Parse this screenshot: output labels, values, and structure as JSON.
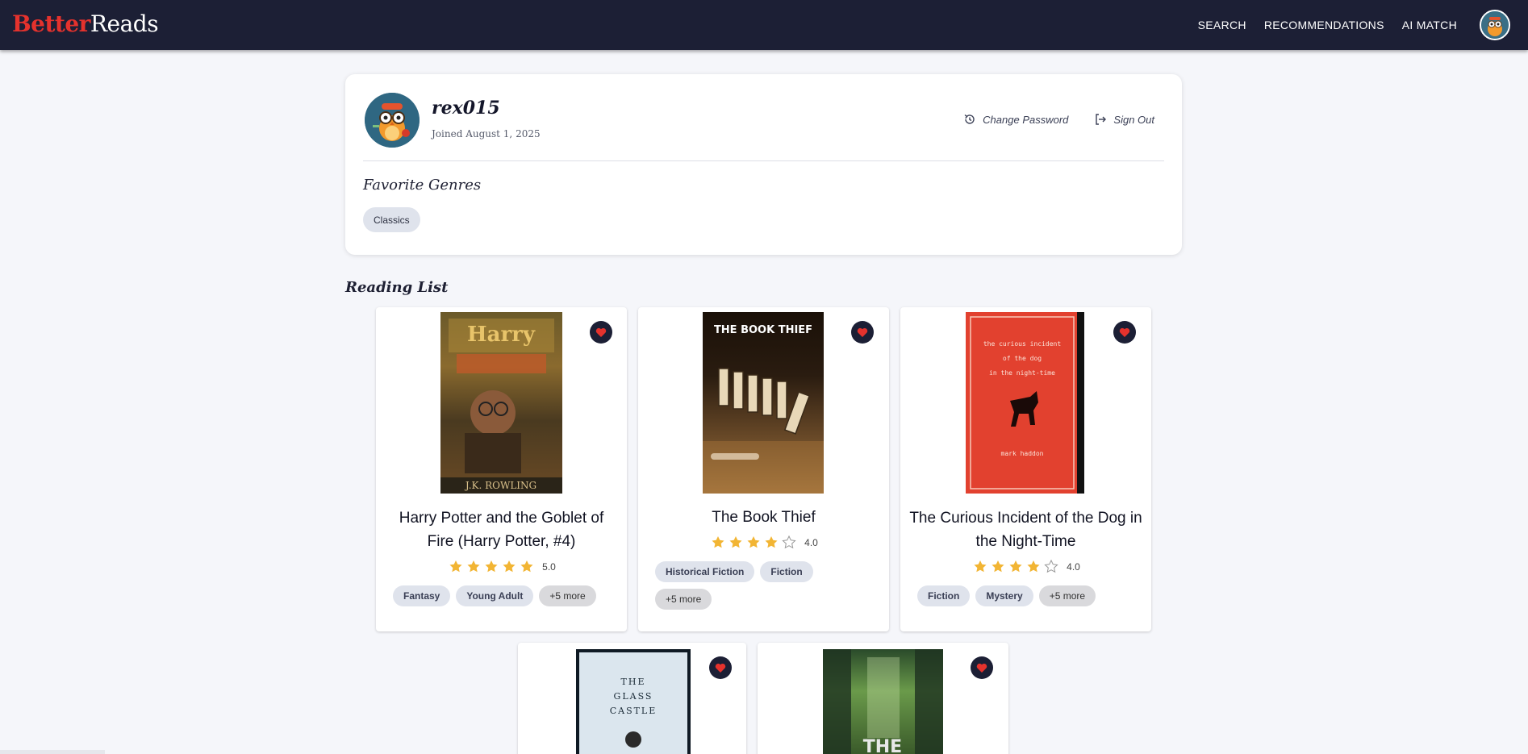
{
  "app": {
    "logo_part1": "Better",
    "logo_part2": "Reads",
    "accent_color": "#e5322d",
    "nav_bg_color": "#1c1f35"
  },
  "nav": {
    "items": [
      {
        "label": "SEARCH"
      },
      {
        "label": "RECOMMENDATIONS"
      },
      {
        "label": "AI MATCH"
      }
    ],
    "avatar_icon": "owl-avatar-icon"
  },
  "profile": {
    "username": "rex015",
    "joined": "Joined August 1, 2025",
    "change_password_label": "Change Password",
    "sign_out_label": "Sign Out",
    "favorite_genres_title": "Favorite Genres",
    "favorite_genres": [
      "Classics"
    ]
  },
  "reading_list": {
    "title": "Reading List",
    "books": [
      {
        "title": "Harry Potter and the Goblet of Fire (Harry Potter, #4)",
        "rating": 5.0,
        "rating_label": "5.0",
        "genres": [
          "Fantasy",
          "Young Adult"
        ],
        "more_label": "+5 more",
        "favorited": true
      },
      {
        "title": "The Book Thief",
        "rating": 4.0,
        "rating_label": "4.0",
        "genres": [
          "Historical Fiction",
          "Fiction"
        ],
        "more_label": "+5 more",
        "favorited": true
      },
      {
        "title": "The Curious Incident of the Dog in the Night-Time",
        "rating": 4.0,
        "rating_label": "4.0",
        "genres": [
          "Fiction",
          "Mystery"
        ],
        "more_label": "+5 more",
        "favorited": true
      },
      {
        "title": "The Glass Castle",
        "favorited": true
      },
      {
        "title": "The Maze Runner",
        "favorited": true
      }
    ]
  }
}
